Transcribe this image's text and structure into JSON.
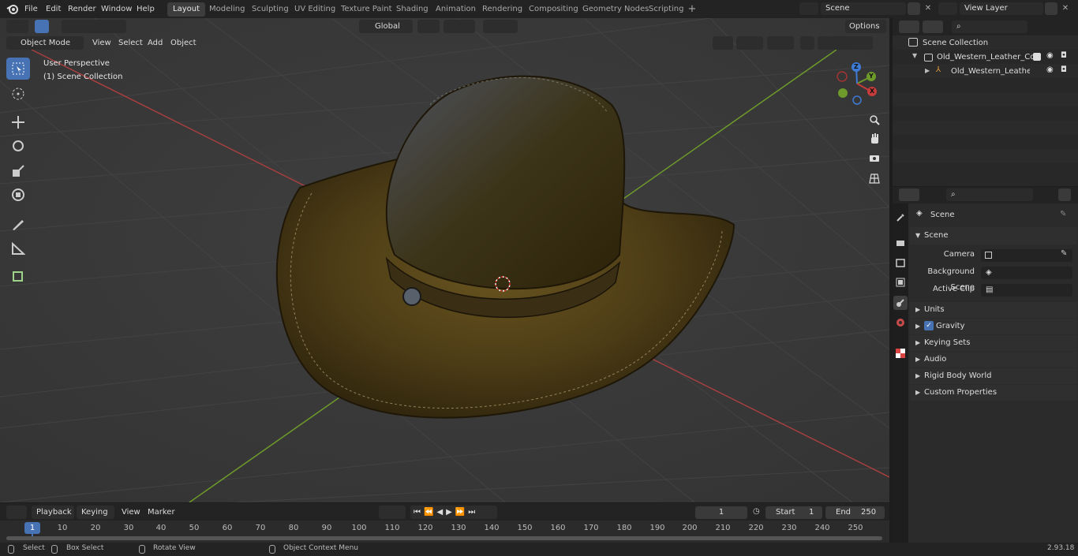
{
  "top_menu": {
    "file": "File",
    "edit": "Edit",
    "render": "Render",
    "window": "Window",
    "help": "Help"
  },
  "workspaces": [
    "Layout",
    "Modeling",
    "Sculpting",
    "UV Editing",
    "Texture Paint",
    "Shading",
    "Animation",
    "Rendering",
    "Compositing",
    "Geometry Nodes",
    "Scripting"
  ],
  "scene_field": "Scene",
  "view_layer_field": "View Layer",
  "viewport": {
    "mode": "Object Mode",
    "menus": [
      "View",
      "Select",
      "Add",
      "Object"
    ],
    "orientation": "Global",
    "options": "Options",
    "info_line1": "User Perspective",
    "info_line2": "(1) Scene Collection"
  },
  "gizmo": {
    "x": "X",
    "y": "Y",
    "z": "Z"
  },
  "outliner": {
    "root": "Scene Collection",
    "items": [
      {
        "label": "Old_Western_Leather_Cowbc"
      },
      {
        "label": "Old_Western_Leather_Cc"
      }
    ]
  },
  "properties": {
    "header": "Scene",
    "section": "Scene",
    "camera_label": "Camera",
    "bg_scene_label": "Background Scene",
    "active_clip_label": "Active Clip",
    "panels": [
      "Units",
      "Gravity",
      "Keying Sets",
      "Audio",
      "Rigid Body World",
      "Custom Properties"
    ]
  },
  "timeline": {
    "menus": [
      "Playback",
      "Keying",
      "View",
      "Marker"
    ],
    "current_frame": "1",
    "start_label": "Start",
    "start": "1",
    "end_label": "End",
    "end": "250",
    "ticks": [
      "1",
      "10",
      "20",
      "30",
      "40",
      "50",
      "60",
      "70",
      "80",
      "90",
      "100",
      "110",
      "120",
      "130",
      "140",
      "150",
      "160",
      "170",
      "180",
      "190",
      "200",
      "210",
      "220",
      "230",
      "240",
      "250"
    ]
  },
  "status": {
    "select": "Select",
    "box_select": "Box Select",
    "rotate_view": "Rotate View",
    "context_menu": "Object Context Menu",
    "version": "2.93.18"
  }
}
